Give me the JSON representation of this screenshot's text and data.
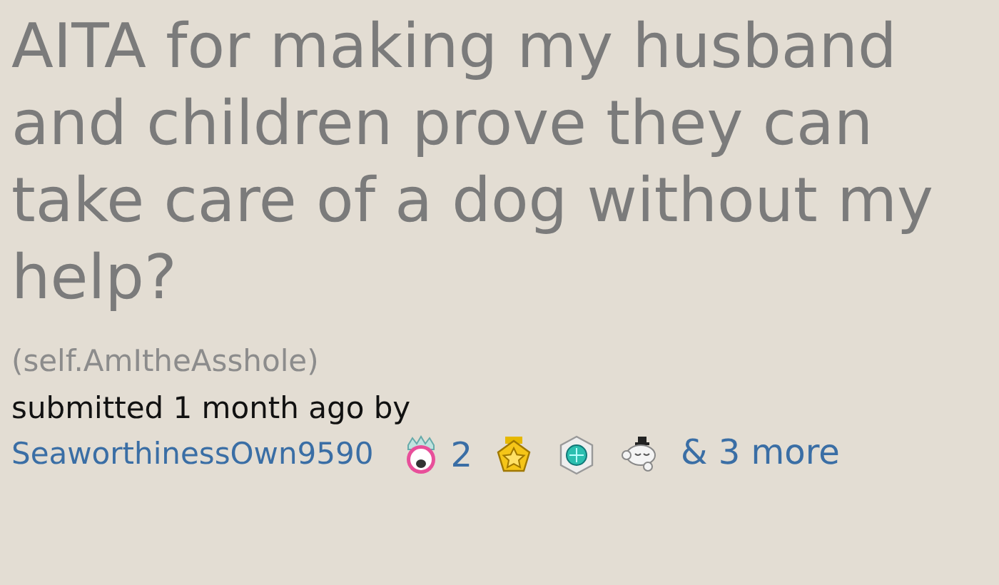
{
  "post": {
    "title": "AITA for making my husband and children prove they can take care of a dog without my help?",
    "domain": "(self.AmItheAsshole)",
    "tagline": "submitted 1 month ago by",
    "author": "SeaworthinessOwn9590",
    "awards": [
      {
        "kind": "crown-face",
        "count": "2"
      },
      {
        "kind": "star-medal"
      },
      {
        "kind": "gem-badge"
      },
      {
        "kind": "cloud-face"
      }
    ],
    "more_awards": "& 3 more"
  }
}
